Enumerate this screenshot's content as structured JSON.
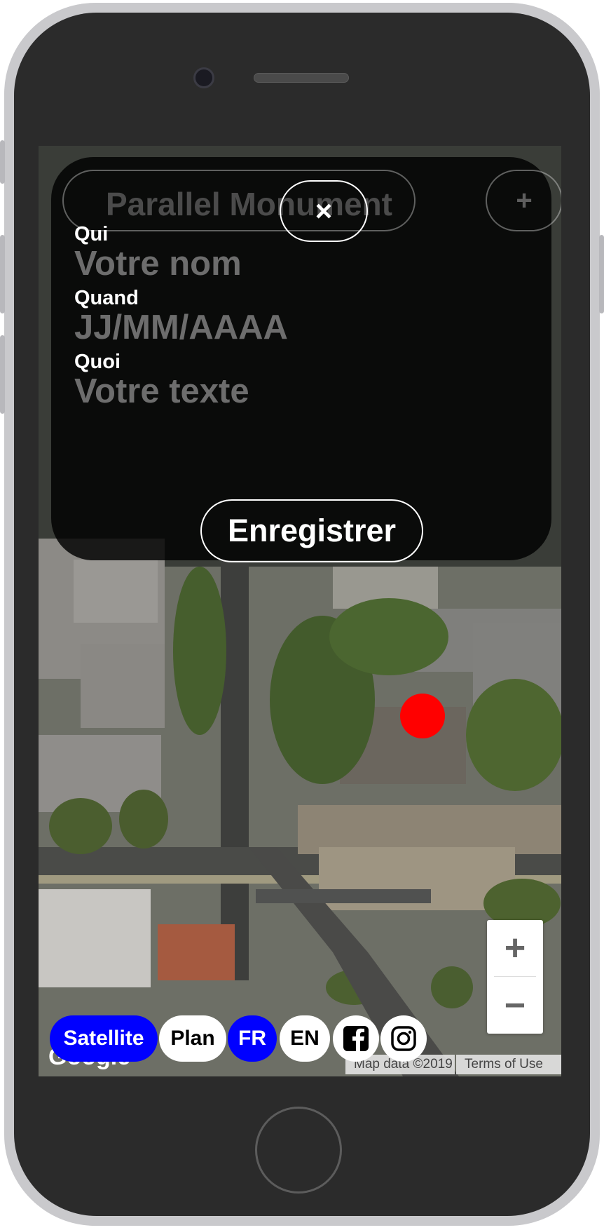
{
  "app": {
    "title": "Parallel Monument"
  },
  "header": {
    "add_icon": "+",
    "close_icon": "×"
  },
  "form": {
    "who_label": "Qui",
    "who_placeholder": "Votre nom",
    "when_label": "Quand",
    "when_placeholder": "JJ/MM/AAAA",
    "what_label": "Quoi",
    "what_placeholder": "Votre texte",
    "save_label": "Enregistrer"
  },
  "map": {
    "zoom_in": "+",
    "zoom_out": "−",
    "attribution": "Map data ©2019",
    "terms": "Terms of Use",
    "logo": "Google",
    "marker_color": "#ff0000"
  },
  "bottom_bar": {
    "satellite": "Satellite",
    "plan": "Plan",
    "lang_fr": "FR",
    "lang_en": "EN",
    "facebook_icon": "facebook-icon",
    "instagram_icon": "instagram-icon",
    "active_color": "#0000ff"
  }
}
